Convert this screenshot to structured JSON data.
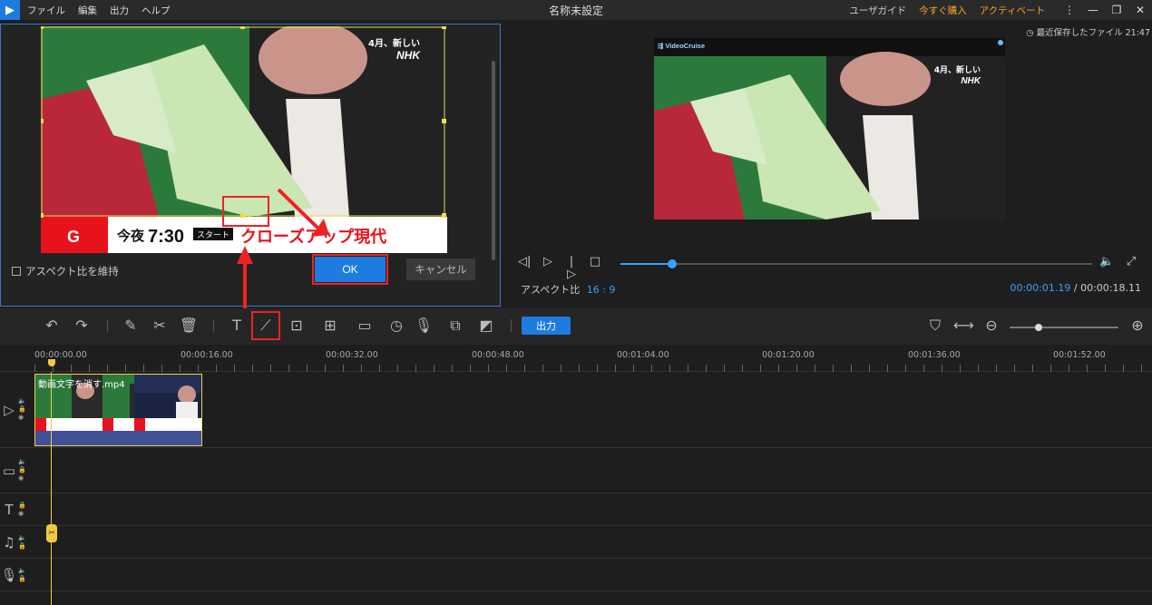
{
  "titlebar": {
    "menu": [
      "ファイル",
      "編集",
      "出力",
      "ヘルプ"
    ],
    "title": "名称未設定",
    "user_guide": "ユーザガイド",
    "buy_now": "今すぐ購入",
    "activate": "アクティベート"
  },
  "crop": {
    "video": {
      "badge_line1": "4月、新しい",
      "badge_line2": "NHK",
      "bottom_g": "G",
      "bottom_time_prefix": "今夜",
      "bottom_time": "7:30",
      "bottom_start": "スタート",
      "bottom_program": "クローズアップ現代"
    },
    "keep_aspect_label": "アスペクト比を維持",
    "ok_label": "OK",
    "cancel_label": "キャンセル"
  },
  "preview": {
    "autosave": "最近保存したファイル 21:47",
    "watermark": "VideoCruise",
    "badge_line1": "4月、新しい",
    "badge_line2": "NHK",
    "aspect_label": "アスペクト比",
    "aspect_value": "16 : 9",
    "current_time": "00:00:01.19",
    "separator": "/",
    "total_time": "00:00:18.11",
    "progress": 0.11
  },
  "toolbar": {
    "export_label": "出力"
  },
  "ruler": {
    "labels": [
      "00:00:00.00",
      "00:00:16.00",
      "00:00:32.00",
      "00:00:48.00",
      "00:01:04.00",
      "00:01:20.00",
      "00:01:36.00",
      "00:01:52.00"
    ]
  },
  "timeline": {
    "clip_name": "動画文字を消す.mp4",
    "thumb_caption": "今夜7:30 クローズアップ現代"
  },
  "colors": {
    "accent": "#1e7be0",
    "highlight": "#e22222",
    "playhead": "#f5c842",
    "orange_link": "#f5a623"
  }
}
